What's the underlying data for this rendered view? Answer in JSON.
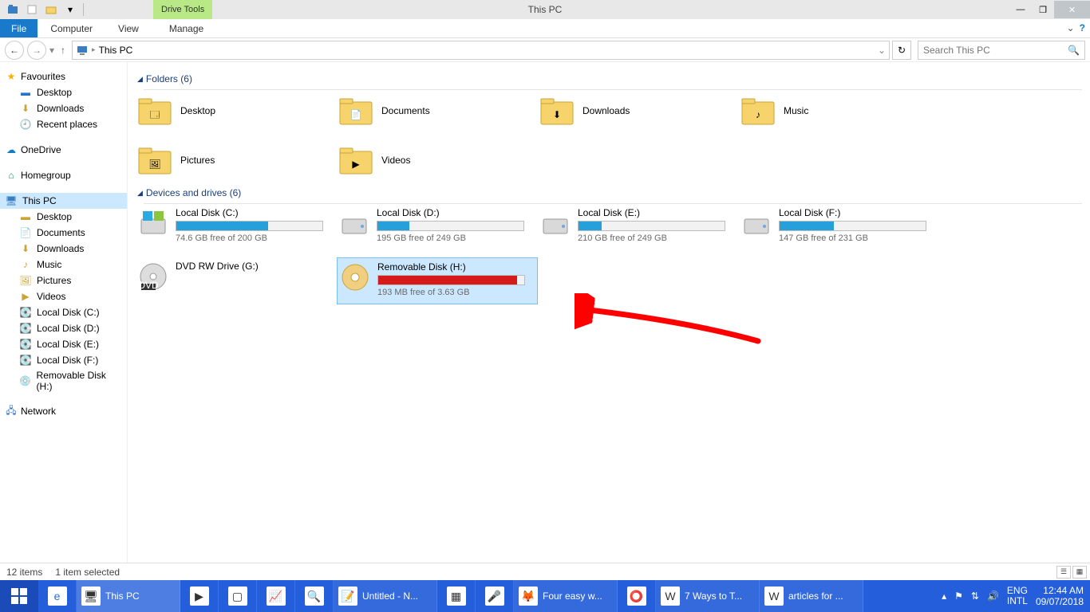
{
  "title": "This PC",
  "drive_tools_label": "Drive Tools",
  "ribbon": {
    "file": "File",
    "tabs": [
      "Computer",
      "View",
      "Manage"
    ]
  },
  "breadcrumb": "This PC",
  "search_placeholder": "Search This PC",
  "sidebar": {
    "favourites": {
      "label": "Favourites",
      "items": [
        "Desktop",
        "Downloads",
        "Recent places"
      ]
    },
    "onedrive": "OneDrive",
    "homegroup": "Homegroup",
    "thispc": {
      "label": "This PC",
      "items": [
        "Desktop",
        "Documents",
        "Downloads",
        "Music",
        "Pictures",
        "Videos",
        "Local Disk (C:)",
        "Local Disk (D:)",
        "Local Disk (E:)",
        "Local Disk (F:)",
        "Removable Disk (H:)"
      ]
    },
    "network": "Network"
  },
  "sections": {
    "folders_label": "Folders (6)",
    "drives_label": "Devices and drives (6)"
  },
  "folders": [
    {
      "name": "Desktop"
    },
    {
      "name": "Documents"
    },
    {
      "name": "Downloads"
    },
    {
      "name": "Music"
    },
    {
      "name": "Pictures"
    },
    {
      "name": "Videos"
    }
  ],
  "drives": [
    {
      "name": "Local Disk (C:)",
      "free": "74.6 GB free of 200 GB",
      "pct": 63,
      "color": "blue"
    },
    {
      "name": "Local Disk (D:)",
      "free": "195 GB free of 249 GB",
      "pct": 22,
      "color": "blue"
    },
    {
      "name": "Local Disk (E:)",
      "free": "210 GB free of 249 GB",
      "pct": 16,
      "color": "blue"
    },
    {
      "name": "Local Disk (F:)",
      "free": "147 GB free of 231 GB",
      "pct": 37,
      "color": "blue"
    },
    {
      "name": "DVD RW Drive (G:)",
      "free": "",
      "pct": -1,
      "color": ""
    },
    {
      "name": "Removable Disk (H:)",
      "free": "193 MB free of 3.63 GB",
      "pct": 95,
      "color": "red",
      "selected": true
    }
  ],
  "status": {
    "count": "12 items",
    "selected": "1 item selected"
  },
  "taskbar": {
    "items": [
      {
        "label": "This PC",
        "active": true
      },
      {
        "label": ""
      },
      {
        "label": ""
      },
      {
        "label": ""
      },
      {
        "label": ""
      },
      {
        "label": "Untitled - N..."
      },
      {
        "label": ""
      },
      {
        "label": ""
      },
      {
        "label": "Four easy w..."
      },
      {
        "label": ""
      },
      {
        "label": "7 Ways to T..."
      },
      {
        "label": "articles for ..."
      }
    ],
    "lang1": "ENG",
    "lang2": "INTL",
    "time": "12:44 AM",
    "date": "09/07/2018"
  }
}
